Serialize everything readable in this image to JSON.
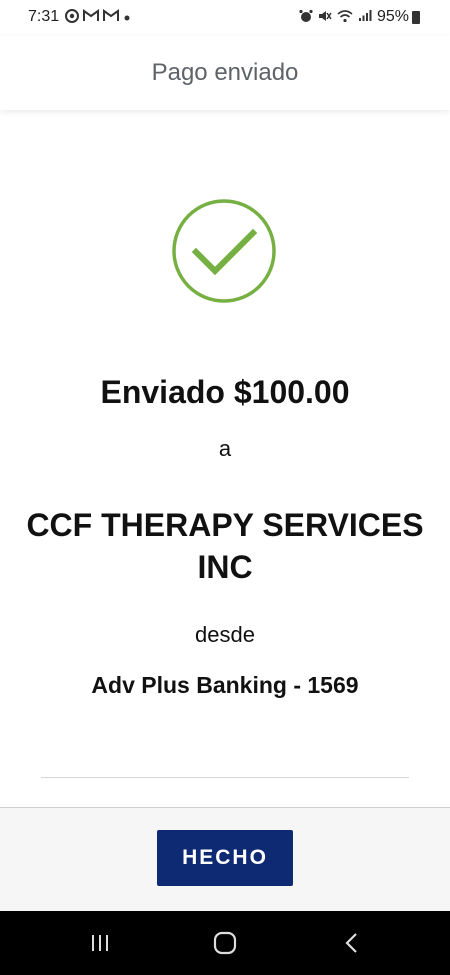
{
  "status_bar": {
    "time": "7:31",
    "battery": "95%",
    "left_icons": [
      "chrome-icon",
      "gmail-icon",
      "gmail-icon",
      "dot-icon"
    ],
    "right_icons": [
      "alarm-icon",
      "mute-icon",
      "wifi-icon",
      "signal-icon",
      "battery-icon"
    ]
  },
  "header": {
    "title": "Pago enviado"
  },
  "confirmation": {
    "sent_text": "Enviado $100.00",
    "to_word": "a",
    "payee_line1": "CCF THERAPY SERVICES",
    "payee_line2": "INC",
    "from_word": "desde",
    "account": "Adv Plus Banking - 1569",
    "check_color": "#76b043"
  },
  "footer": {
    "done_label": "HECHO",
    "button_color": "#0e2a73"
  },
  "nav_bar": {
    "icons": [
      "recent-apps-icon",
      "home-icon",
      "back-icon"
    ]
  }
}
